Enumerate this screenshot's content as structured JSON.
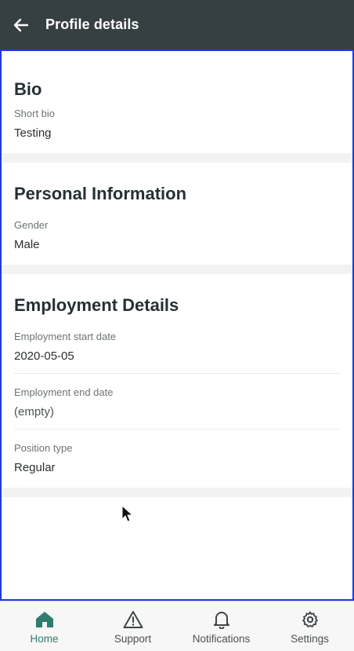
{
  "header": {
    "title": "Profile details",
    "back_icon": "arrow-left-icon"
  },
  "sections": [
    {
      "heading": "Bio",
      "fields": [
        {
          "label": "Short bio",
          "value": "Testing"
        }
      ]
    },
    {
      "heading": "Personal Information",
      "fields": [
        {
          "label": "Gender",
          "value": "Male"
        }
      ]
    },
    {
      "heading": "Employment Details",
      "fields": [
        {
          "label": "Employment start date",
          "value": "2020-05-05"
        },
        {
          "label": "Employment end date",
          "value": "(empty)"
        },
        {
          "label": "Position type",
          "value": "Regular"
        }
      ]
    }
  ],
  "bottom_nav": {
    "items": [
      {
        "label": "Home",
        "icon": "home-icon",
        "active": true
      },
      {
        "label": "Support",
        "icon": "warning-icon",
        "active": false
      },
      {
        "label": "Notifications",
        "icon": "bell-icon",
        "active": false
      },
      {
        "label": "Settings",
        "icon": "gear-icon",
        "active": false
      }
    ]
  },
  "colors": {
    "app_bar": "#364042",
    "accent": "#2e7d6f",
    "frame_border": "#1f3bd8"
  }
}
